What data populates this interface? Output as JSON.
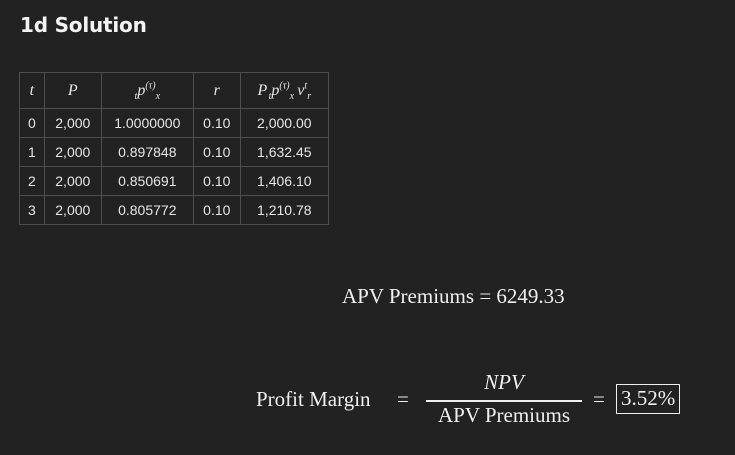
{
  "section": {
    "title": "1d Solution"
  },
  "table": {
    "headers": {
      "t": "t",
      "P": "P",
      "tpx_pre": "t",
      "tpx_p": "p",
      "tpx_sup": "(τ)",
      "tpx_sub": "x",
      "r": "r",
      "pv_P": "P",
      "pv_pre": "t",
      "pv_p": "p",
      "pv_sup": "(τ)",
      "pv_sub": "x",
      "pv_v": "v",
      "pv_vsup": "t",
      "pv_vsub": "r"
    },
    "rows": [
      {
        "t": "0",
        "P": "2,000",
        "tpx": "1.0000000",
        "r": "0.10",
        "pv": "2,000.00"
      },
      {
        "t": "1",
        "P": "2,000",
        "tpx": "0.897848",
        "r": "0.10",
        "pv": "1,632.45"
      },
      {
        "t": "2",
        "P": "2,000",
        "tpx": "0.850691",
        "r": "0.10",
        "pv": "1,406.10"
      },
      {
        "t": "3",
        "P": "2,000",
        "tpx": "0.805772",
        "r": "0.10",
        "pv": "1,210.78"
      }
    ]
  },
  "apv": {
    "label": "APV Premiums",
    "equals": "=",
    "value": "6249.33"
  },
  "profit_margin": {
    "label": "Profit Margin",
    "equals1": "=",
    "numerator": "NPV",
    "denominator": "APV Premiums",
    "equals2": "=",
    "result": "3.52%"
  }
}
